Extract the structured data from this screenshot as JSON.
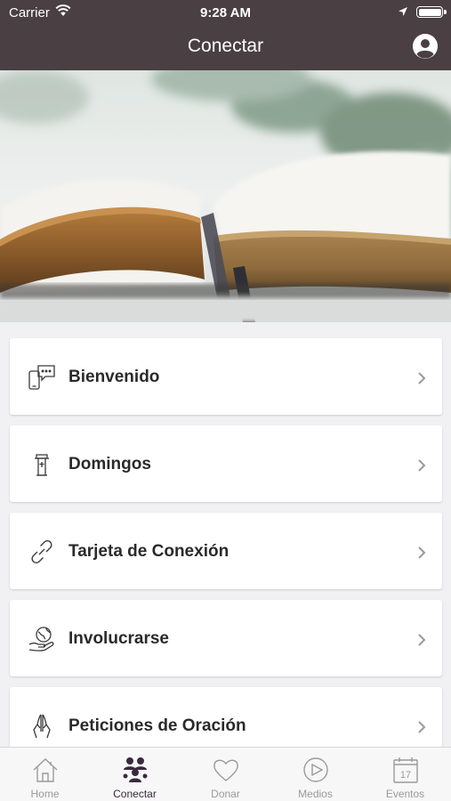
{
  "status_bar": {
    "carrier": "Carrier",
    "time": "9:28 AM"
  },
  "nav": {
    "title": "Conectar"
  },
  "list": {
    "items": [
      {
        "label": "Bienvenido",
        "icon": "welcome-phone-chat-icon"
      },
      {
        "label": "Domingos",
        "icon": "pulpit-icon"
      },
      {
        "label": "Tarjeta de Conexión",
        "icon": "link-icon"
      },
      {
        "label": "Involucrarse",
        "icon": "hand-globe-icon"
      },
      {
        "label": "Peticiones de Oración",
        "icon": "praying-hands-icon"
      }
    ]
  },
  "tabbar": {
    "tabs": [
      {
        "label": "Home",
        "icon": "home-icon",
        "active": false
      },
      {
        "label": "Conectar",
        "icon": "people-icon",
        "active": true
      },
      {
        "label": "Donar",
        "icon": "heart-icon",
        "active": false
      },
      {
        "label": "Medios",
        "icon": "play-icon",
        "active": false
      },
      {
        "label": "Eventos",
        "icon": "calendar-icon",
        "active": false,
        "calendar_day": "17"
      }
    ]
  },
  "colors": {
    "nav_background": "#4a3f43",
    "active_tab": "#3a2a3d",
    "inactive_tab": "#9a9a9a"
  }
}
